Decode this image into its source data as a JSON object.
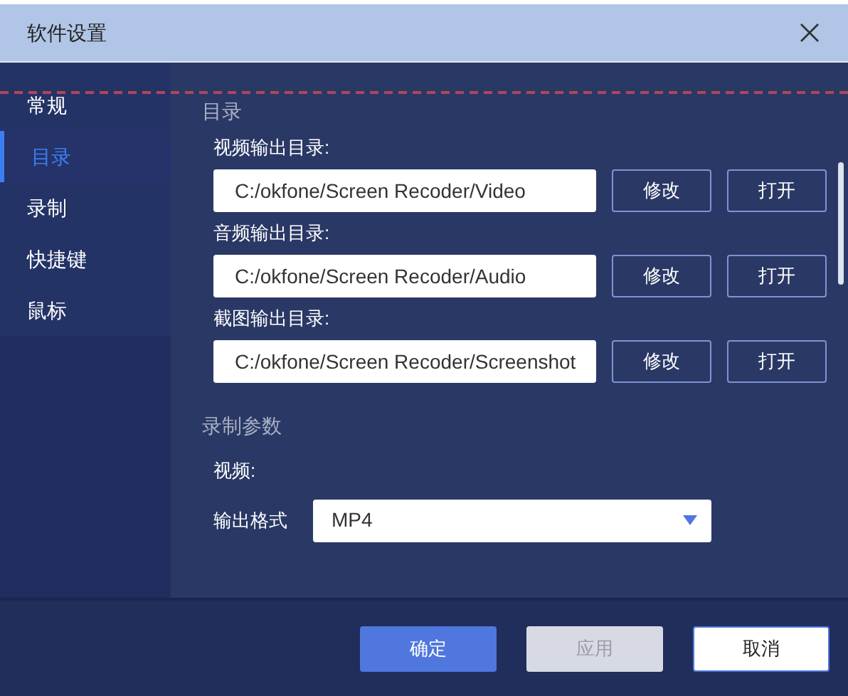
{
  "window": {
    "title": "软件设置"
  },
  "sidebar": {
    "items": [
      {
        "label": "常规",
        "selected": false
      },
      {
        "label": "目录",
        "selected": true
      },
      {
        "label": "录制",
        "selected": false
      },
      {
        "label": "快捷键",
        "selected": false
      },
      {
        "label": "鼠标",
        "selected": false
      }
    ]
  },
  "directory_section": {
    "heading": "目录",
    "rows": [
      {
        "label": "视频输出目录:",
        "value": "C:/okfone/Screen Recoder/Video",
        "buttons": [
          "修改",
          "打开"
        ]
      },
      {
        "label": "音频输出目录:",
        "value": "C:/okfone/Screen Recoder/Audio",
        "buttons": [
          "修改",
          "打开"
        ]
      },
      {
        "label": "截图输出目录:",
        "value": "C:/okfone/Screen Recoder/Screenshot",
        "buttons": [
          "修改",
          "打开"
        ]
      }
    ]
  },
  "recording_section": {
    "heading": "录制参数",
    "subheading": "视频:",
    "format": {
      "label": "输出格式",
      "value": "MP4"
    }
  },
  "footer": {
    "buttons": [
      {
        "label": "确定",
        "kind": "primary",
        "disabled": false
      },
      {
        "label": "应用",
        "kind": "secondary",
        "disabled": true
      },
      {
        "label": "取消",
        "kind": "outline",
        "disabled": false
      }
    ]
  }
}
